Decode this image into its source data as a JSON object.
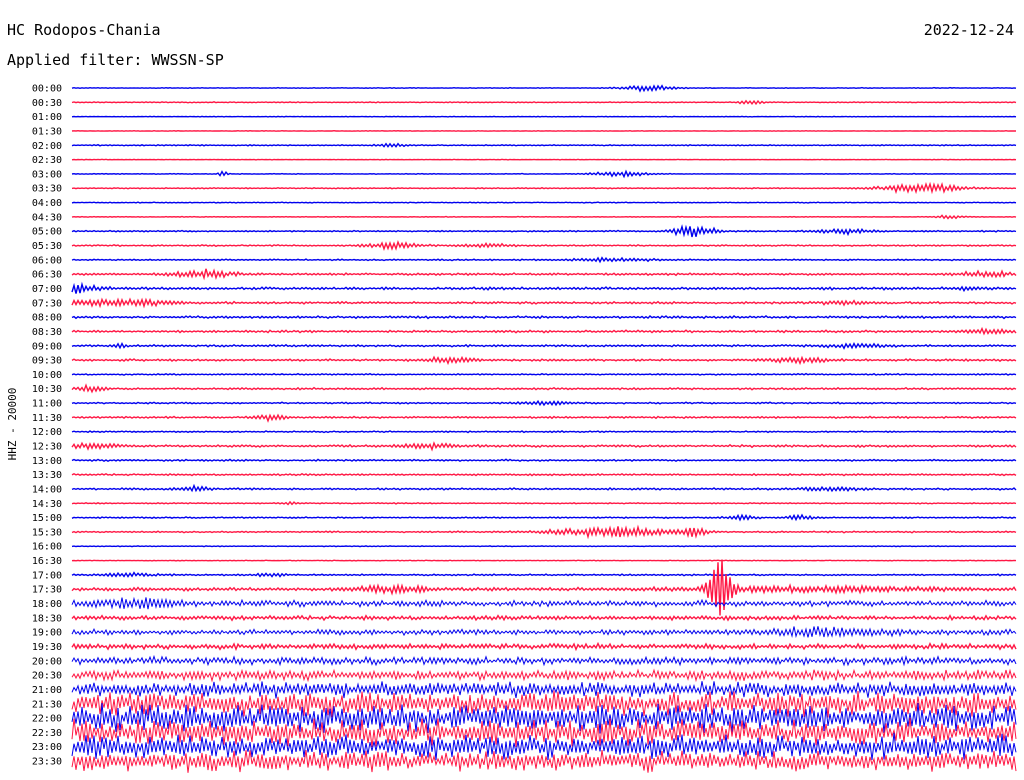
{
  "header": {
    "station": "HC Rodopos-Chania",
    "filter": "Applied filter: WWSSN-SP",
    "date": "2022-12-24"
  },
  "chart_data": {
    "type": "line",
    "title": "HC Rodopos-Chania",
    "subtitle": "Applied filter: WWSSN-SP",
    "ylabel": "HHZ - 20000",
    "xlabel": "",
    "colors": [
      "#0000ee",
      "#ff1744"
    ],
    "grid": false,
    "rows": [
      {
        "t": "00:00",
        "noise": 0.4,
        "events": [
          {
            "pos": 0.61,
            "amp": 3,
            "w": 0.02
          }
        ]
      },
      {
        "t": "00:30",
        "noise": 0.5,
        "events": [
          {
            "pos": 0.72,
            "amp": 2,
            "w": 0.01
          }
        ]
      },
      {
        "t": "01:00",
        "noise": 0.3,
        "events": []
      },
      {
        "t": "01:30",
        "noise": 0.3,
        "events": []
      },
      {
        "t": "02:00",
        "noise": 0.6,
        "events": [
          {
            "pos": 0.34,
            "amp": 2,
            "w": 0.01
          }
        ]
      },
      {
        "t": "02:30",
        "noise": 0.3,
        "events": []
      },
      {
        "t": "03:00",
        "noise": 0.4,
        "events": [
          {
            "pos": 0.16,
            "amp": 4,
            "w": 0.003
          },
          {
            "pos": 0.58,
            "amp": 3,
            "w": 0.02
          }
        ]
      },
      {
        "t": "03:30",
        "noise": 0.6,
        "events": [
          {
            "pos": 0.9,
            "amp": 5,
            "w": 0.03
          }
        ]
      },
      {
        "t": "04:00",
        "noise": 0.5,
        "events": []
      },
      {
        "t": "04:30",
        "noise": 0.4,
        "events": [
          {
            "pos": 0.93,
            "amp": 2,
            "w": 0.01
          }
        ]
      },
      {
        "t": "05:00",
        "noise": 0.8,
        "events": [
          {
            "pos": 0.66,
            "amp": 7,
            "w": 0.015
          },
          {
            "pos": 0.82,
            "amp": 3,
            "w": 0.02
          }
        ]
      },
      {
        "t": "05:30",
        "noise": 0.8,
        "events": [
          {
            "pos": 0.34,
            "amp": 4,
            "w": 0.02
          },
          {
            "pos": 0.44,
            "amp": 2,
            "w": 0.02
          }
        ]
      },
      {
        "t": "06:00",
        "noise": 0.8,
        "events": [
          {
            "pos": 0.57,
            "amp": 2,
            "w": 0.03
          }
        ]
      },
      {
        "t": "06:30",
        "noise": 1.2,
        "events": [
          {
            "pos": 0.14,
            "amp": 5,
            "w": 0.02
          },
          {
            "pos": 0.97,
            "amp": 3,
            "w": 0.02
          }
        ]
      },
      {
        "t": "07:00",
        "noise": 1.5,
        "events": [
          {
            "pos": 0.0,
            "amp": 4,
            "w": 0.02
          },
          {
            "pos": 0.95,
            "amp": 2,
            "w": 0.01
          }
        ]
      },
      {
        "t": "07:30",
        "noise": 1.2,
        "events": [
          {
            "pos": 0.05,
            "amp": 4,
            "w": 0.04
          },
          {
            "pos": 0.82,
            "amp": 2,
            "w": 0.02
          }
        ]
      },
      {
        "t": "08:00",
        "noise": 1.3,
        "events": []
      },
      {
        "t": "08:30",
        "noise": 1.3,
        "events": [
          {
            "pos": 0.97,
            "amp": 2,
            "w": 0.02
          }
        ]
      },
      {
        "t": "09:00",
        "noise": 1.1,
        "events": [
          {
            "pos": 0.05,
            "amp": 3,
            "w": 0.005
          },
          {
            "pos": 0.83,
            "amp": 3,
            "w": 0.02
          }
        ]
      },
      {
        "t": "09:30",
        "noise": 1.2,
        "events": [
          {
            "pos": 0.4,
            "amp": 3,
            "w": 0.02
          },
          {
            "pos": 0.77,
            "amp": 3,
            "w": 0.02
          }
        ]
      },
      {
        "t": "10:00",
        "noise": 0.8,
        "events": []
      },
      {
        "t": "10:30",
        "noise": 1.1,
        "events": [
          {
            "pos": 0.02,
            "amp": 3,
            "w": 0.01
          }
        ]
      },
      {
        "t": "11:00",
        "noise": 0.9,
        "events": [
          {
            "pos": 0.5,
            "amp": 2,
            "w": 0.02
          }
        ]
      },
      {
        "t": "11:30",
        "noise": 1.0,
        "events": [
          {
            "pos": 0.21,
            "amp": 4,
            "w": 0.01
          }
        ]
      },
      {
        "t": "12:00",
        "noise": 0.8,
        "events": []
      },
      {
        "t": "12:30",
        "noise": 1.3,
        "events": [
          {
            "pos": 0.02,
            "amp": 3,
            "w": 0.02
          },
          {
            "pos": 0.38,
            "amp": 3,
            "w": 0.02
          }
        ]
      },
      {
        "t": "13:00",
        "noise": 1.0,
        "events": []
      },
      {
        "t": "13:30",
        "noise": 1.0,
        "events": []
      },
      {
        "t": "14:00",
        "noise": 1.1,
        "events": [
          {
            "pos": 0.13,
            "amp": 3,
            "w": 0.01
          },
          {
            "pos": 0.8,
            "amp": 2,
            "w": 0.02
          }
        ]
      },
      {
        "t": "14:30",
        "noise": 0.6,
        "events": [
          {
            "pos": 0.23,
            "amp": 2,
            "w": 0.005
          }
        ]
      },
      {
        "t": "15:00",
        "noise": 0.8,
        "events": [
          {
            "pos": 0.71,
            "amp": 3,
            "w": 0.01
          },
          {
            "pos": 0.77,
            "amp": 3,
            "w": 0.01
          }
        ]
      },
      {
        "t": "15:30",
        "noise": 0.9,
        "events": [
          {
            "pos": 0.57,
            "amp": 6,
            "w": 0.04
          },
          {
            "pos": 0.66,
            "amp": 6,
            "w": 0.01
          }
        ]
      },
      {
        "t": "16:00",
        "noise": 0.4,
        "events": []
      },
      {
        "t": "16:30",
        "noise": 0.4,
        "events": []
      },
      {
        "t": "17:00",
        "noise": 0.9,
        "events": [
          {
            "pos": 0.06,
            "amp": 2,
            "w": 0.02
          },
          {
            "pos": 0.21,
            "amp": 2,
            "w": 0.01
          }
        ]
      },
      {
        "t": "17:30",
        "noise": 1.8,
        "events": [
          {
            "pos": 0.686,
            "amp": 40,
            "w": 0.008
          },
          {
            "pos": 0.34,
            "amp": 4,
            "w": 0.03
          },
          {
            "pos": 0.78,
            "amp": 3,
            "w": 0.1
          }
        ]
      },
      {
        "t": "18:00",
        "noise": 3.5,
        "events": [
          {
            "pos": 0.07,
            "amp": 5,
            "w": 0.03
          }
        ]
      },
      {
        "t": "18:30",
        "noise": 2.5,
        "events": []
      },
      {
        "t": "19:00",
        "noise": 3.2,
        "events": [
          {
            "pos": 0.8,
            "amp": 4,
            "w": 0.04
          }
        ]
      },
      {
        "t": "19:30",
        "noise": 3.0,
        "events": []
      },
      {
        "t": "20:00",
        "noise": 4.5,
        "events": []
      },
      {
        "t": "20:30",
        "noise": 6.0,
        "events": []
      },
      {
        "t": "21:00",
        "noise": 9.0,
        "events": []
      },
      {
        "t": "21:30",
        "noise": 14.0,
        "events": []
      },
      {
        "t": "22:00",
        "noise": 16.0,
        "events": []
      },
      {
        "t": "22:30",
        "noise": 15.0,
        "events": []
      },
      {
        "t": "23:00",
        "noise": 14.0,
        "events": []
      },
      {
        "t": "23:30",
        "noise": 12.0,
        "events": []
      }
    ]
  }
}
